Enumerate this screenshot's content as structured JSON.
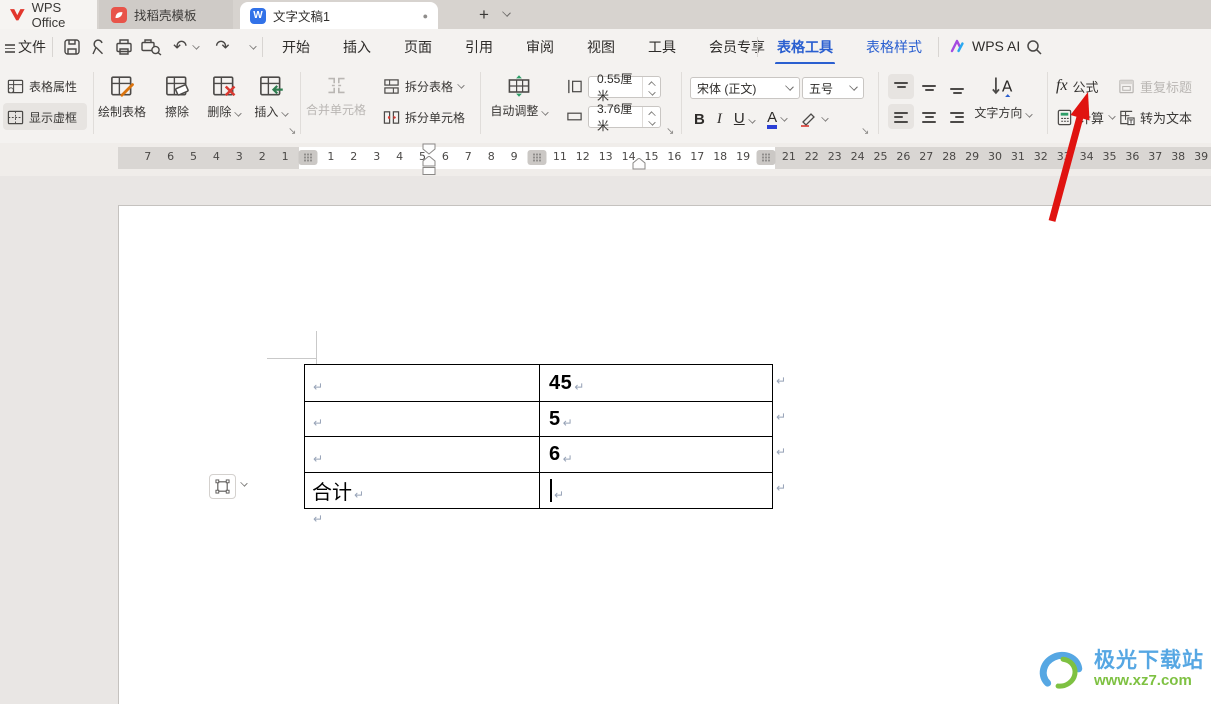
{
  "tab_bar": {
    "home_label": "WPS Office",
    "template_tab": "找稻壳模板",
    "doc_tab": "文字文稿1",
    "dirty_dot": "●",
    "new_tab": "+"
  },
  "menu_bar": {
    "file": "文件",
    "items": [
      "开始",
      "插入",
      "页面",
      "引用",
      "审阅",
      "视图",
      "工具",
      "会员专享"
    ],
    "table_tool_tab": "表格工具",
    "table_style_tab": "表格样式",
    "wps_ai": "WPS AI"
  },
  "ribbon": {
    "table_properties": "表格属性",
    "show_gridlines": "显示虚框",
    "draw_table": "绘制表格",
    "eraser": "擦除",
    "delete": "删除",
    "insert": "插入",
    "merge_cells": "合并单元格",
    "split_table": "拆分表格",
    "split_cells": "拆分单元格",
    "autofit": "自动调整",
    "row_height_value": "0.55厘米",
    "col_width_value": "3.76厘米",
    "font_name": "宋体 (正文)",
    "font_size": "五号",
    "bold": "B",
    "italic": "I",
    "underline": "U",
    "font_color_letter": "A",
    "text_direction": "文字方向",
    "formula_fx": "fx",
    "formula": "公式",
    "repeat_header": "重复标题",
    "calculate": "计算",
    "to_text": "转为文本"
  },
  "ruler": {
    "sequence": [
      "7",
      "6",
      "5",
      "4",
      "3",
      "2",
      "1",
      "#",
      "1",
      "2",
      "3",
      "4",
      "5",
      "6",
      "7",
      "8",
      "9",
      "#",
      "11",
      "12",
      "13",
      "14",
      "15",
      "16",
      "17",
      "18",
      "19",
      "#",
      "21",
      "22",
      "23",
      "24",
      "25",
      "26",
      "27",
      "28",
      "29",
      "30",
      "31",
      "32",
      "33",
      "34",
      "35",
      "36",
      "37",
      "38",
      "39"
    ]
  },
  "document": {
    "table": {
      "rows": [
        {
          "label": "",
          "value": "45"
        },
        {
          "label": "",
          "value": "5"
        },
        {
          "label": "",
          "value": "6"
        },
        {
          "label": "合计",
          "value": ""
        }
      ],
      "cursor_row": 3
    },
    "pilcrow": "↵"
  },
  "icons": {
    "undo": "↶",
    "redo": "↷",
    "launcher": "↘",
    "search": "magnifier",
    "save": "floppy",
    "print": "printer",
    "print_preview": "printer-with-magnifier",
    "export_pdf": "pen-loop"
  },
  "watermark": {
    "name": "极光下载站",
    "url": "www.xz7.com"
  },
  "colors": {
    "accent_blue": "#2a5fd0",
    "arrow_red": "#e01310",
    "disabled_gray": "#b9b6b3",
    "watermark_blue": "#56a7e3",
    "watermark_green": "#7ec142",
    "table_border": "#000000"
  }
}
